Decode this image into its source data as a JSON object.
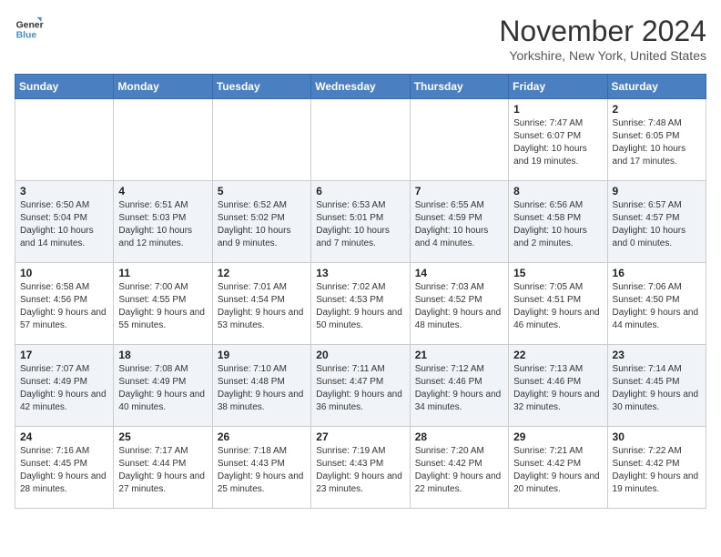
{
  "header": {
    "logo_line1": "General",
    "logo_line2": "Blue",
    "month": "November 2024",
    "location": "Yorkshire, New York, United States"
  },
  "weekdays": [
    "Sunday",
    "Monday",
    "Tuesday",
    "Wednesday",
    "Thursday",
    "Friday",
    "Saturday"
  ],
  "weeks": [
    [
      {
        "day": "",
        "sunrise": "",
        "sunset": "",
        "daylight": ""
      },
      {
        "day": "",
        "sunrise": "",
        "sunset": "",
        "daylight": ""
      },
      {
        "day": "",
        "sunrise": "",
        "sunset": "",
        "daylight": ""
      },
      {
        "day": "",
        "sunrise": "",
        "sunset": "",
        "daylight": ""
      },
      {
        "day": "",
        "sunrise": "",
        "sunset": "",
        "daylight": ""
      },
      {
        "day": "1",
        "sunrise": "Sunrise: 7:47 AM",
        "sunset": "Sunset: 6:07 PM",
        "daylight": "Daylight: 10 hours and 19 minutes."
      },
      {
        "day": "2",
        "sunrise": "Sunrise: 7:48 AM",
        "sunset": "Sunset: 6:05 PM",
        "daylight": "Daylight: 10 hours and 17 minutes."
      }
    ],
    [
      {
        "day": "3",
        "sunrise": "Sunrise: 6:50 AM",
        "sunset": "Sunset: 5:04 PM",
        "daylight": "Daylight: 10 hours and 14 minutes."
      },
      {
        "day": "4",
        "sunrise": "Sunrise: 6:51 AM",
        "sunset": "Sunset: 5:03 PM",
        "daylight": "Daylight: 10 hours and 12 minutes."
      },
      {
        "day": "5",
        "sunrise": "Sunrise: 6:52 AM",
        "sunset": "Sunset: 5:02 PM",
        "daylight": "Daylight: 10 hours and 9 minutes."
      },
      {
        "day": "6",
        "sunrise": "Sunrise: 6:53 AM",
        "sunset": "Sunset: 5:01 PM",
        "daylight": "Daylight: 10 hours and 7 minutes."
      },
      {
        "day": "7",
        "sunrise": "Sunrise: 6:55 AM",
        "sunset": "Sunset: 4:59 PM",
        "daylight": "Daylight: 10 hours and 4 minutes."
      },
      {
        "day": "8",
        "sunrise": "Sunrise: 6:56 AM",
        "sunset": "Sunset: 4:58 PM",
        "daylight": "Daylight: 10 hours and 2 minutes."
      },
      {
        "day": "9",
        "sunrise": "Sunrise: 6:57 AM",
        "sunset": "Sunset: 4:57 PM",
        "daylight": "Daylight: 10 hours and 0 minutes."
      }
    ],
    [
      {
        "day": "10",
        "sunrise": "Sunrise: 6:58 AM",
        "sunset": "Sunset: 4:56 PM",
        "daylight": "Daylight: 9 hours and 57 minutes."
      },
      {
        "day": "11",
        "sunrise": "Sunrise: 7:00 AM",
        "sunset": "Sunset: 4:55 PM",
        "daylight": "Daylight: 9 hours and 55 minutes."
      },
      {
        "day": "12",
        "sunrise": "Sunrise: 7:01 AM",
        "sunset": "Sunset: 4:54 PM",
        "daylight": "Daylight: 9 hours and 53 minutes."
      },
      {
        "day": "13",
        "sunrise": "Sunrise: 7:02 AM",
        "sunset": "Sunset: 4:53 PM",
        "daylight": "Daylight: 9 hours and 50 minutes."
      },
      {
        "day": "14",
        "sunrise": "Sunrise: 7:03 AM",
        "sunset": "Sunset: 4:52 PM",
        "daylight": "Daylight: 9 hours and 48 minutes."
      },
      {
        "day": "15",
        "sunrise": "Sunrise: 7:05 AM",
        "sunset": "Sunset: 4:51 PM",
        "daylight": "Daylight: 9 hours and 46 minutes."
      },
      {
        "day": "16",
        "sunrise": "Sunrise: 7:06 AM",
        "sunset": "Sunset: 4:50 PM",
        "daylight": "Daylight: 9 hours and 44 minutes."
      }
    ],
    [
      {
        "day": "17",
        "sunrise": "Sunrise: 7:07 AM",
        "sunset": "Sunset: 4:49 PM",
        "daylight": "Daylight: 9 hours and 42 minutes."
      },
      {
        "day": "18",
        "sunrise": "Sunrise: 7:08 AM",
        "sunset": "Sunset: 4:49 PM",
        "daylight": "Daylight: 9 hours and 40 minutes."
      },
      {
        "day": "19",
        "sunrise": "Sunrise: 7:10 AM",
        "sunset": "Sunset: 4:48 PM",
        "daylight": "Daylight: 9 hours and 38 minutes."
      },
      {
        "day": "20",
        "sunrise": "Sunrise: 7:11 AM",
        "sunset": "Sunset: 4:47 PM",
        "daylight": "Daylight: 9 hours and 36 minutes."
      },
      {
        "day": "21",
        "sunrise": "Sunrise: 7:12 AM",
        "sunset": "Sunset: 4:46 PM",
        "daylight": "Daylight: 9 hours and 34 minutes."
      },
      {
        "day": "22",
        "sunrise": "Sunrise: 7:13 AM",
        "sunset": "Sunset: 4:46 PM",
        "daylight": "Daylight: 9 hours and 32 minutes."
      },
      {
        "day": "23",
        "sunrise": "Sunrise: 7:14 AM",
        "sunset": "Sunset: 4:45 PM",
        "daylight": "Daylight: 9 hours and 30 minutes."
      }
    ],
    [
      {
        "day": "24",
        "sunrise": "Sunrise: 7:16 AM",
        "sunset": "Sunset: 4:45 PM",
        "daylight": "Daylight: 9 hours and 28 minutes."
      },
      {
        "day": "25",
        "sunrise": "Sunrise: 7:17 AM",
        "sunset": "Sunset: 4:44 PM",
        "daylight": "Daylight: 9 hours and 27 minutes."
      },
      {
        "day": "26",
        "sunrise": "Sunrise: 7:18 AM",
        "sunset": "Sunset: 4:43 PM",
        "daylight": "Daylight: 9 hours and 25 minutes."
      },
      {
        "day": "27",
        "sunrise": "Sunrise: 7:19 AM",
        "sunset": "Sunset: 4:43 PM",
        "daylight": "Daylight: 9 hours and 23 minutes."
      },
      {
        "day": "28",
        "sunrise": "Sunrise: 7:20 AM",
        "sunset": "Sunset: 4:42 PM",
        "daylight": "Daylight: 9 hours and 22 minutes."
      },
      {
        "day": "29",
        "sunrise": "Sunrise: 7:21 AM",
        "sunset": "Sunset: 4:42 PM",
        "daylight": "Daylight: 9 hours and 20 minutes."
      },
      {
        "day": "30",
        "sunrise": "Sunrise: 7:22 AM",
        "sunset": "Sunset: 4:42 PM",
        "daylight": "Daylight: 9 hours and 19 minutes."
      }
    ]
  ]
}
